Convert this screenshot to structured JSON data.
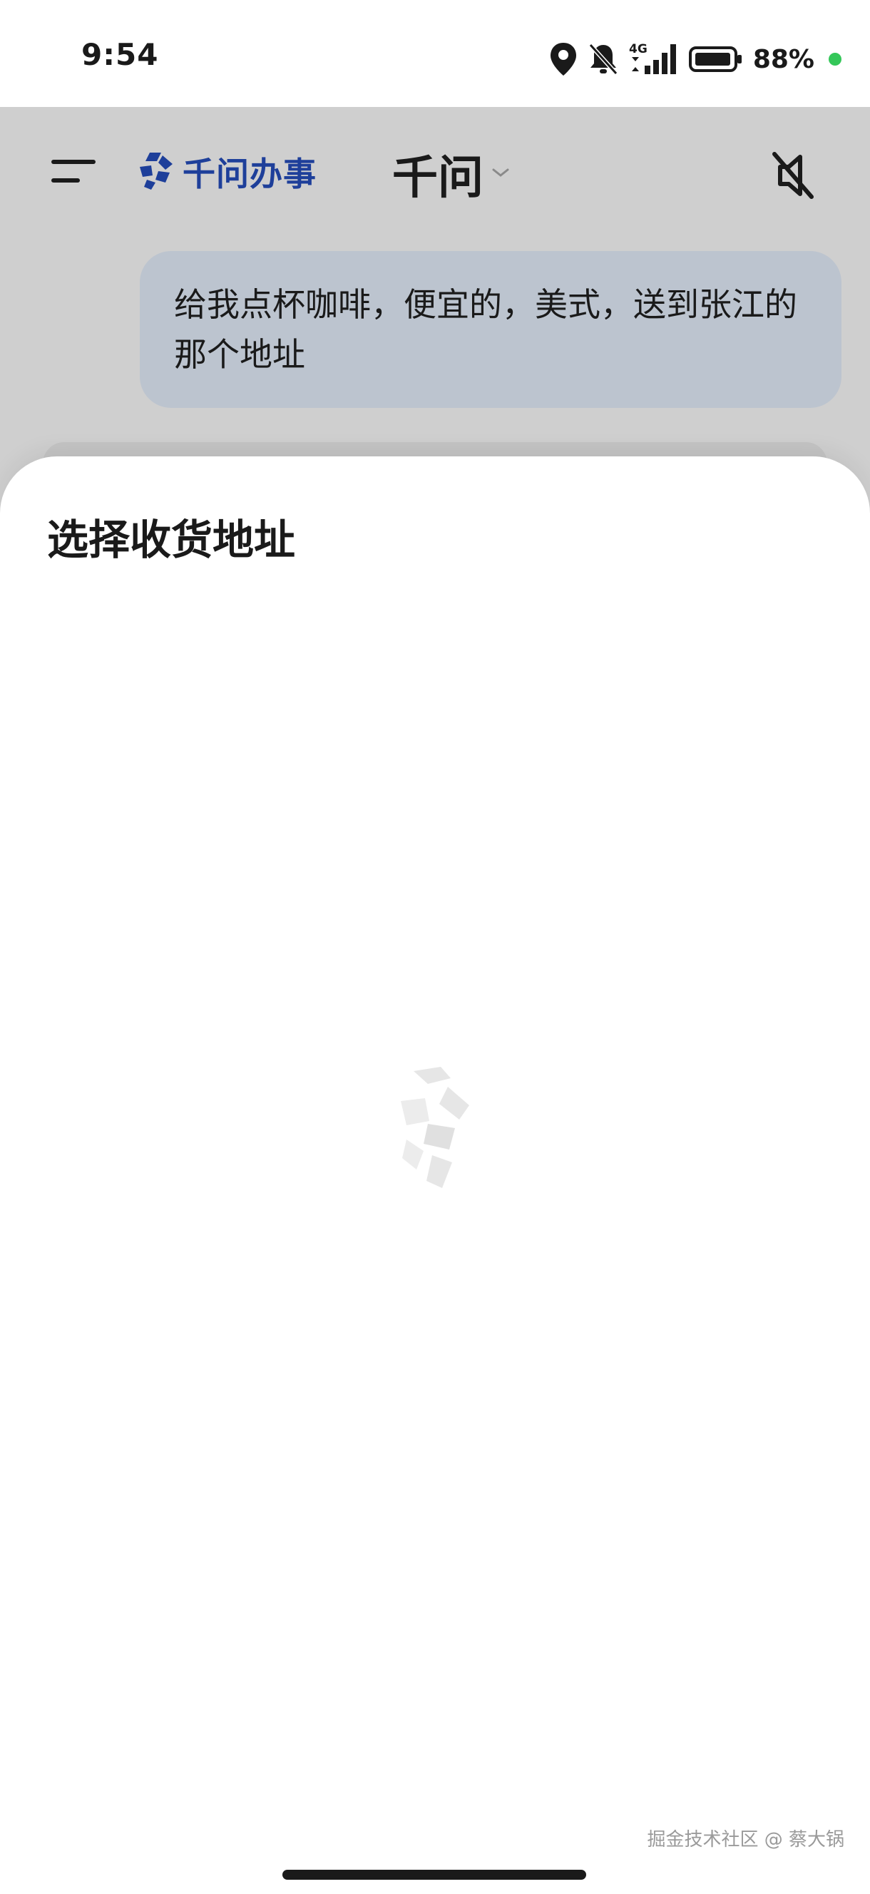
{
  "status_bar": {
    "time": "9:54",
    "network": "4G",
    "battery_percent": "88%",
    "icons": [
      "location-icon",
      "bell-off-icon",
      "signal-icon",
      "battery-icon"
    ],
    "dot_color": "#34c759"
  },
  "header": {
    "brand_name": "千问办事",
    "model_name": "千问",
    "brand_color": "#1e3f9a",
    "icons": [
      "menu-icon",
      "brand-logo-icon",
      "chevron-down-icon",
      "mute-icon"
    ]
  },
  "chat": {
    "user_message": "给我点杯咖啡，便宜的，美式，送到张江的那个地址"
  },
  "sheet": {
    "title": "选择收货地址",
    "state": "loading",
    "icons": [
      "loading-logo-icon"
    ]
  },
  "watermark": "掘金技术社区 @ 蔡大锅"
}
